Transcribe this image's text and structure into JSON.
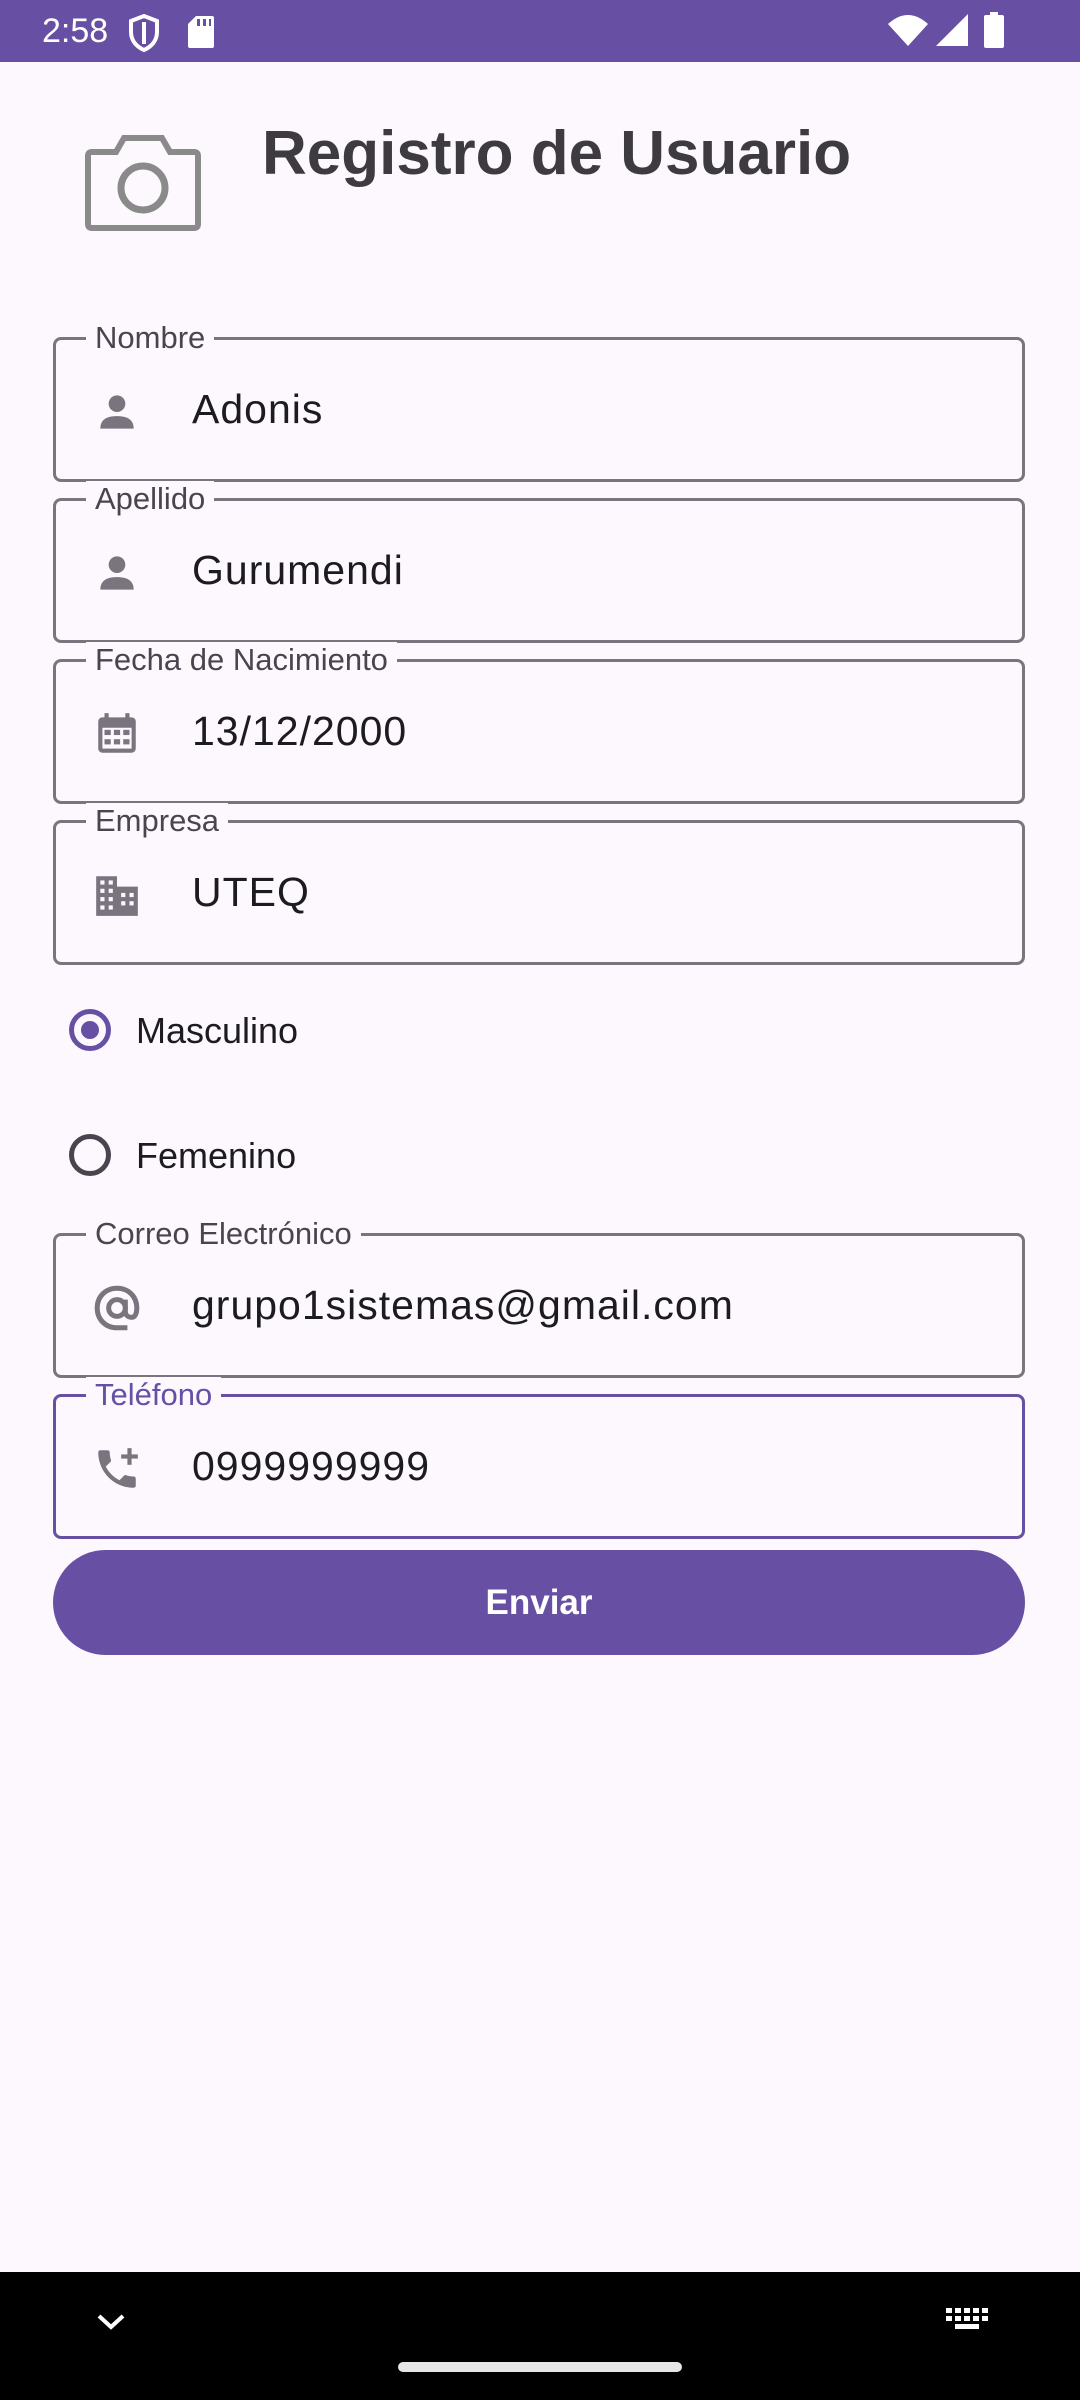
{
  "status_bar": {
    "time": "2:58",
    "icons": [
      "shield-icon",
      "sd-card-icon",
      "wifi-icon",
      "signal-icon",
      "battery-icon"
    ]
  },
  "header": {
    "title": "Registro de Usuario",
    "photo_icon": "camera-icon"
  },
  "form": {
    "nombre": {
      "label": "Nombre",
      "value": "Adonis",
      "icon": "person-icon"
    },
    "apellido": {
      "label": "Apellido",
      "value": "Gurumendi",
      "icon": "person-icon"
    },
    "fecha": {
      "label": "Fecha de Nacimiento",
      "value": "13/12/2000",
      "icon": "calendar-icon"
    },
    "empresa": {
      "label": "Empresa",
      "value": "UTEQ",
      "icon": "business-icon"
    },
    "gender": {
      "options": [
        {
          "label": "Masculino",
          "selected": true
        },
        {
          "label": "Femenino",
          "selected": false
        }
      ]
    },
    "correo": {
      "label": "Correo Electrónico",
      "value": "grupo1sistemas@gmail.com",
      "icon": "at-icon"
    },
    "telefono": {
      "label": "Teléfono",
      "value": "0999999999",
      "icon": "add-call-icon",
      "focused": true
    },
    "submit_label": "Enviar"
  },
  "nav_bar": {
    "icons": [
      "chevron-down-icon",
      "keyboard-icon"
    ]
  },
  "colors": {
    "accent": "#6750A4",
    "background": "#FDF7FE",
    "outline": "#79747E"
  }
}
